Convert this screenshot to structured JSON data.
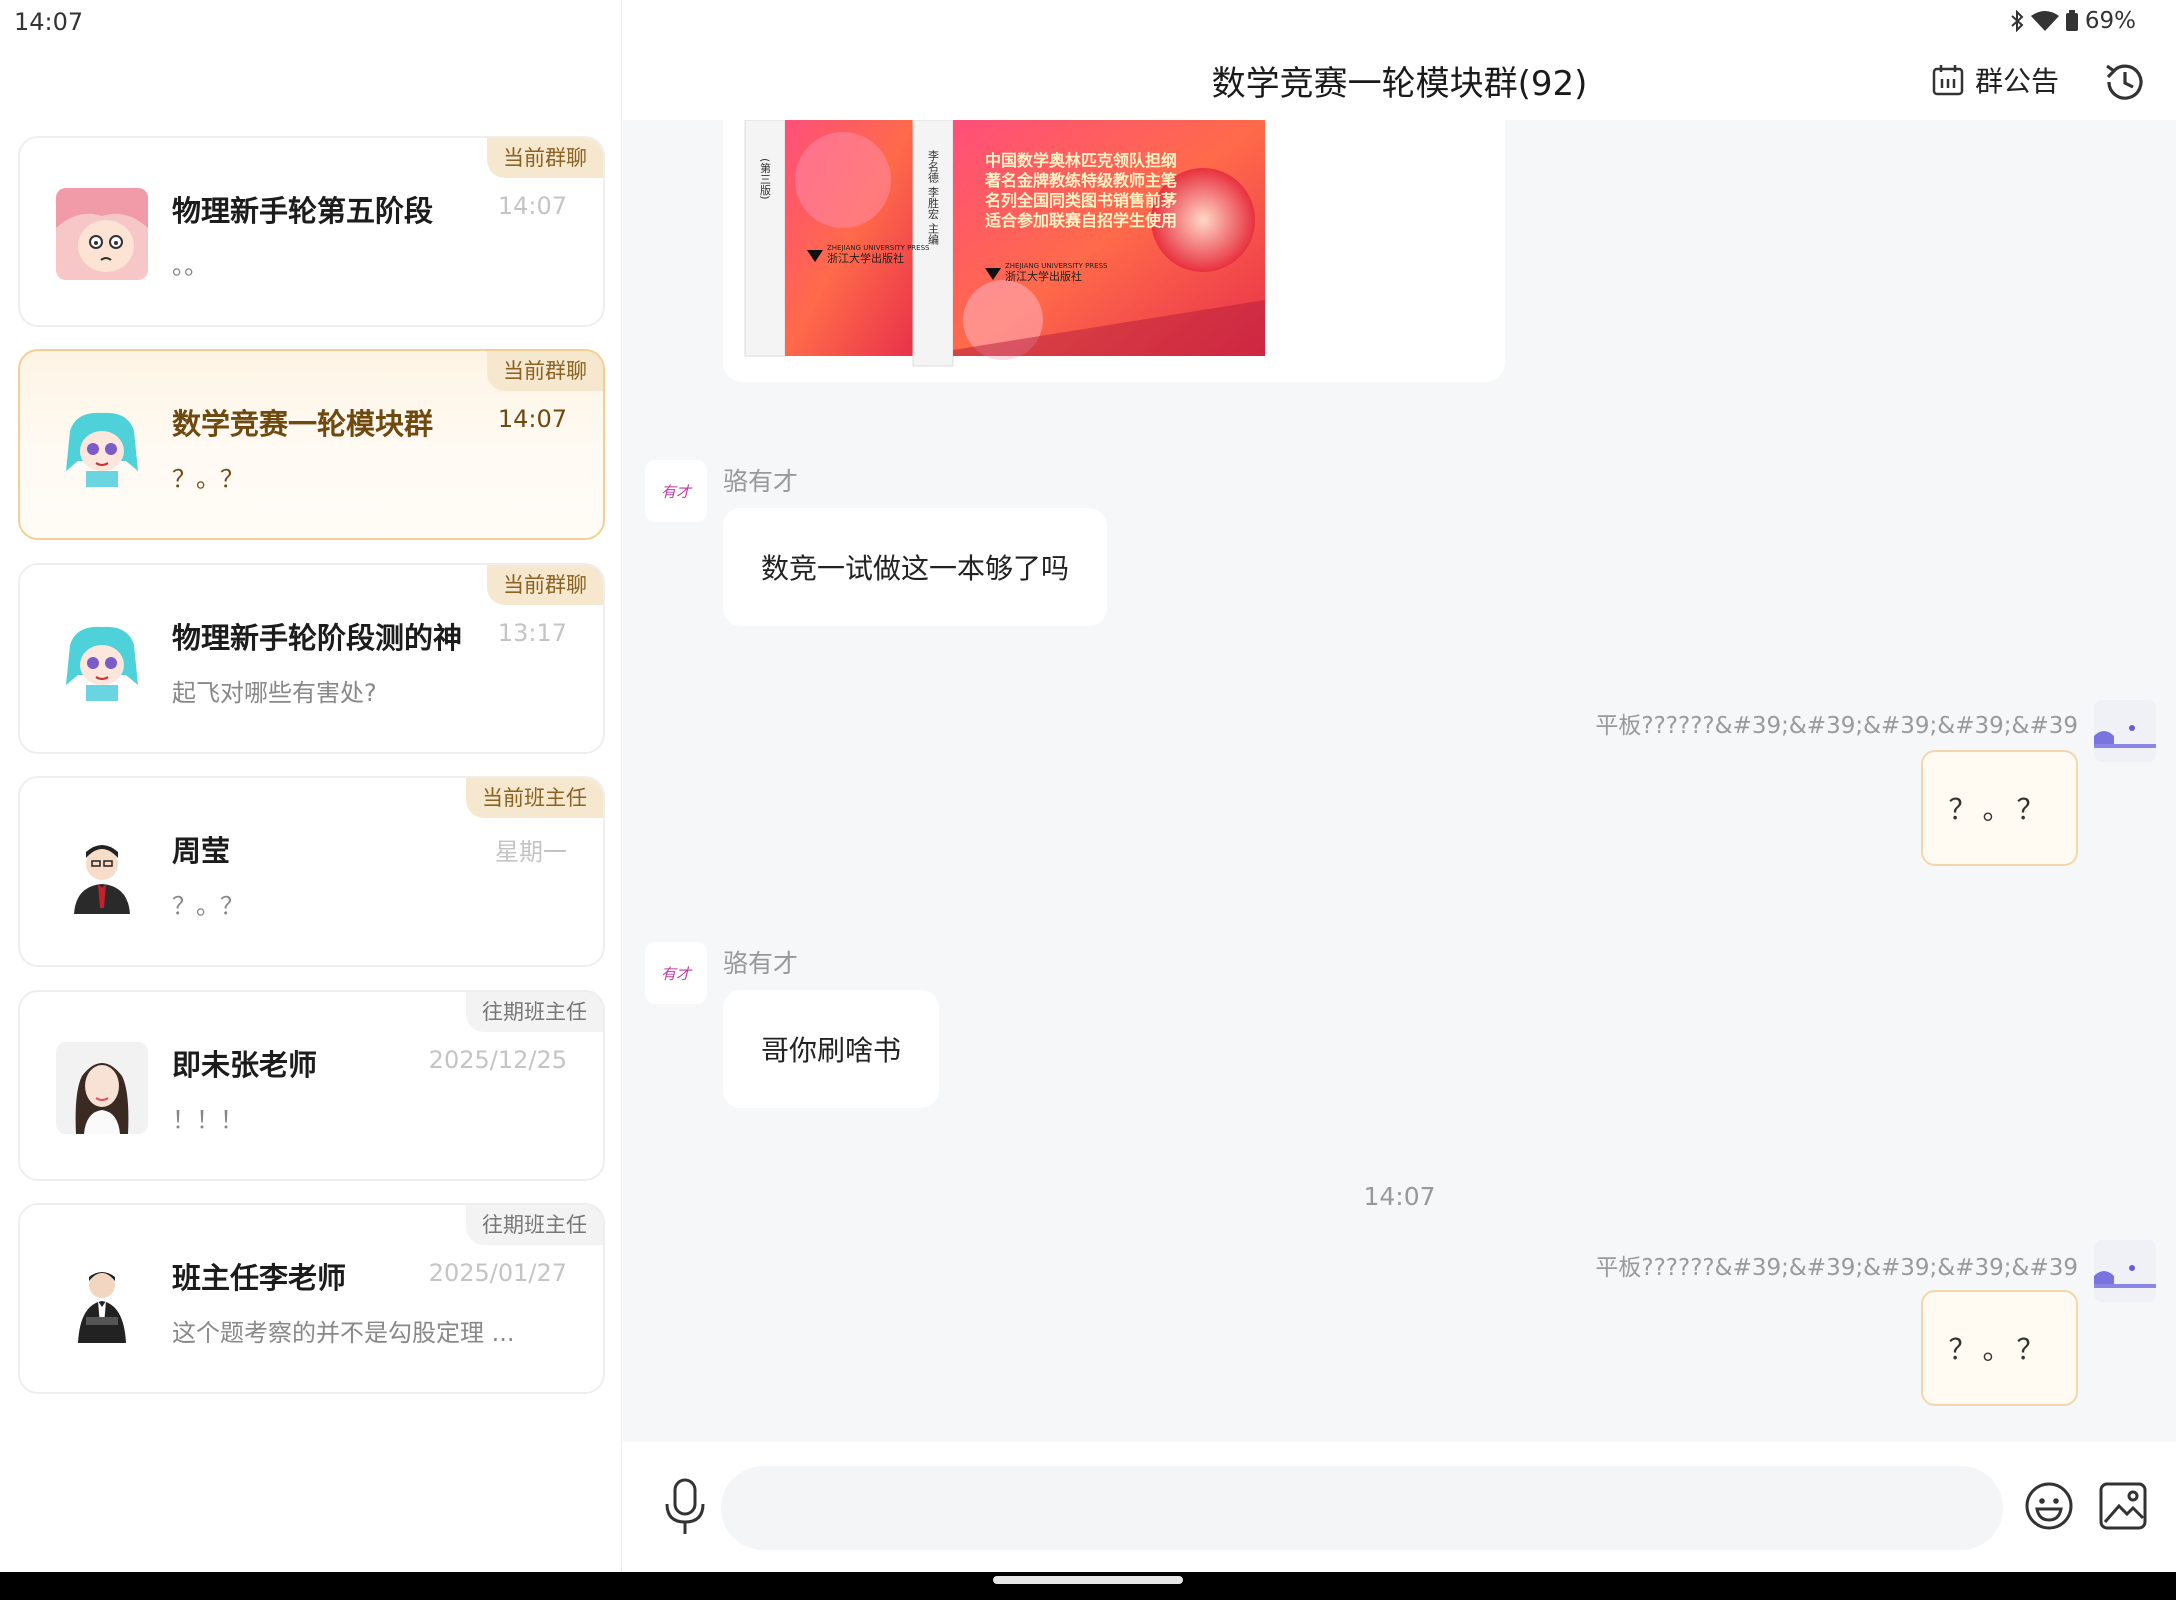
{
  "status_bar": {
    "time": "14:07",
    "battery": "69%"
  },
  "conversations": [
    {
      "name": "物理新手轮第五阶段",
      "preview": "。。",
      "time": "14:07",
      "tag": "当前群聊"
    },
    {
      "name": "数学竞赛一轮模块群",
      "preview": "？。？",
      "time": "14:07",
      "tag": "当前群聊"
    },
    {
      "name": "物理新手轮阶段测的神",
      "preview": "起飞对哪些有害处?",
      "time": "13:17",
      "tag": "当前群聊"
    },
    {
      "name": "周莹",
      "preview": "？。？",
      "time": "星期一",
      "tag": "当前班主任"
    },
    {
      "name": "即未张老师",
      "preview": "！！！",
      "time": "2025/12/25",
      "tag": "往期班主任"
    },
    {
      "name": "班主任李老师",
      "preview": "这个题考察的并不是勾股定理 ...",
      "time": "2025/01/27",
      "tag": "往期班主任"
    }
  ],
  "chat": {
    "title": "数学竞赛一轮模块群(92)",
    "notice_label": "群公告",
    "book": {
      "spine_left": "(第三版)",
      "spine_right": "李名德 李胜宏 主编",
      "publisher": "浙江大学出版社",
      "publisher_en": "ZHEJIANG UNIVERSITY PRESS",
      "cover_lines": [
        "中国数学奥林匹克领队担纲",
        "著名金牌教练特级教师主笔",
        "名列全国同类图书销售前茅",
        "适合参加联赛自招学生使用"
      ]
    },
    "messages": [
      {
        "sender": "骆有才",
        "avatar_text": "有才",
        "text": "数竞一试做这一本够了吗"
      },
      {
        "sender": "平板??????&#39;&#39;&#39;&#39;&#39",
        "text": "？。？"
      },
      {
        "sender": "骆有才",
        "avatar_text": "有才",
        "text": "哥你刷啥书"
      },
      {
        "time_separator": "14:07"
      },
      {
        "sender": "平板??????&#39;&#39;&#39;&#39;&#39",
        "text": "？。？"
      }
    ],
    "input_placeholder": ""
  },
  "colors": {
    "accent": "#f1cf95",
    "active_text": "#6f4a10",
    "tag_bg": "#f6e8ce",
    "panel_bg": "#f6f7f9"
  }
}
